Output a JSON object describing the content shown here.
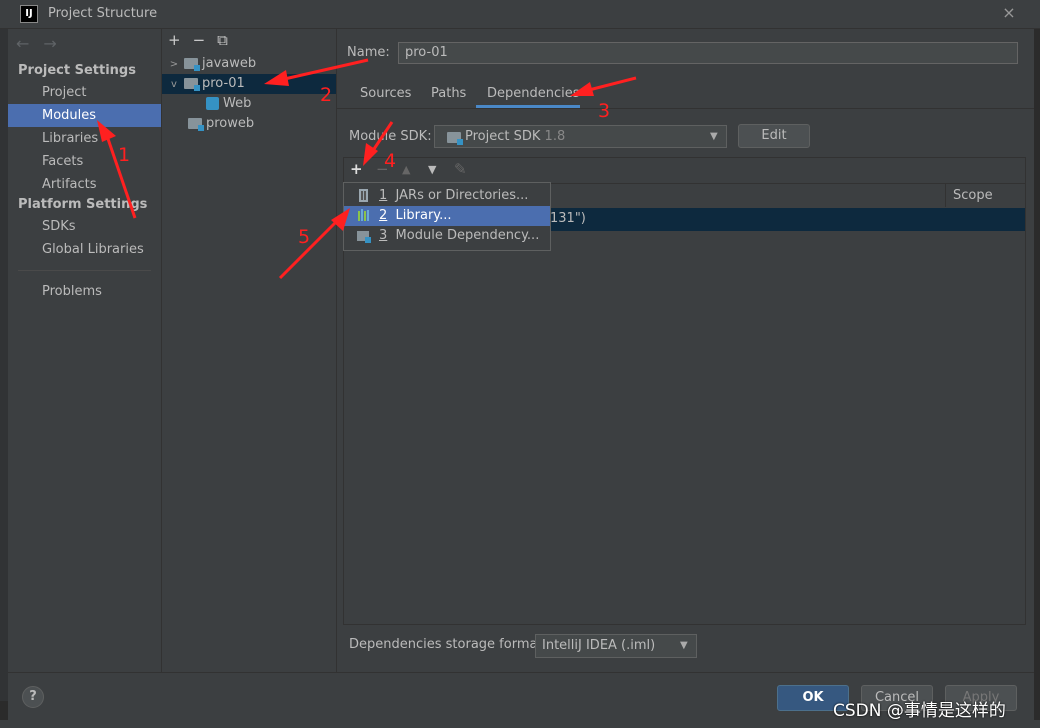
{
  "window": {
    "title": "Project Structure",
    "logo_text": "IJ",
    "close_icon": "×"
  },
  "nav": {
    "back": "←",
    "forward": "→"
  },
  "sidebar": {
    "project_settings_header": "Project Settings",
    "project_items": [
      "Project",
      "Modules",
      "Libraries",
      "Facets",
      "Artifacts"
    ],
    "platform_settings_header": "Platform Settings",
    "platform_items": [
      "SDKs",
      "Global Libraries"
    ],
    "problems": "Problems",
    "selected": "Modules"
  },
  "tree": {
    "toolbar": {
      "add": "+",
      "remove": "−",
      "copy": "⧉"
    },
    "nodes": [
      {
        "label": "javaweb",
        "expander": ">"
      },
      {
        "label": "pro-01",
        "expander": "v",
        "selected": true
      },
      {
        "label": "Web"
      },
      {
        "label": "proweb"
      }
    ]
  },
  "main": {
    "name_label": "Name:",
    "name_value": "pro-01",
    "tabs": [
      "Sources",
      "Paths",
      "Dependencies"
    ],
    "active_tab": "Dependencies",
    "sdk_label": "Module SDK:",
    "sdk_value": "Project SDK",
    "sdk_version": "1.8",
    "edit_button": "Edit",
    "deps_toolbar": {
      "add": "+",
      "remove": "−",
      "up": "▲",
      "down": "▼",
      "edit": "✎"
    },
    "table_header_scope": "Scope",
    "selected_row_text": "131\")",
    "storage_label": "Dependencies storage format:",
    "storage_value": "IntelliJ IDEA (.iml)"
  },
  "popup": {
    "items": [
      {
        "num": "1",
        "label": "JARs or Directories..."
      },
      {
        "num": "2",
        "label": "Library...",
        "selected": true
      },
      {
        "num": "3",
        "label": "Module Dependency..."
      }
    ]
  },
  "buttons": {
    "help": "?",
    "ok": "OK",
    "cancel": "Cancel",
    "apply": "Apply"
  },
  "annotations": [
    "1",
    "2",
    "3",
    "4",
    "5"
  ],
  "watermark": "CSDN @事情是这样的",
  "colors": {
    "selection": "#4b6eaf",
    "tree_selection": "#0d293e",
    "annotation": "#ff2020",
    "ok_button": "#365880"
  }
}
